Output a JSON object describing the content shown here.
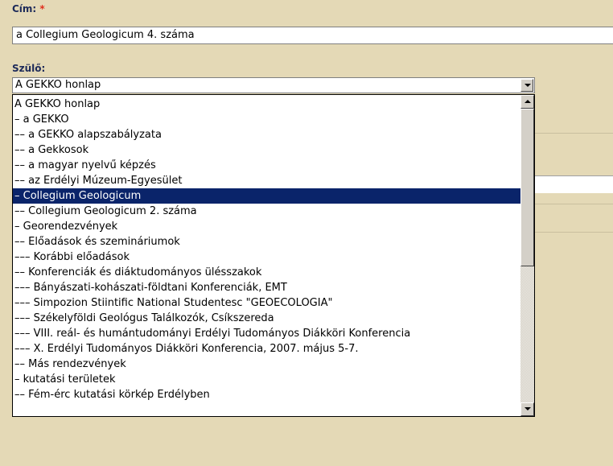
{
  "title_field": {
    "label": "Cím:",
    "required_mark": "*",
    "value": "a Collegium Geologicum 4. száma"
  },
  "parent_field": {
    "label": "Szülő:",
    "selected_value": "A GEKKO honlap"
  },
  "dropdown": {
    "highlight_color": "#0a246a",
    "items": [
      "A GEKKO honlap",
      "– a GEKKO",
      "–– a GEKKO alapszabályzata",
      "–– a Gekkosok",
      "–– a magyar nyelvű képzés",
      "–– az Erdélyi Múzeum-Egyesület",
      "– Collegium Geologicum",
      "–– Collegium Geologicum 2. száma",
      "– Georendezvények",
      "–– Előadások és szemináriumok",
      "––– Korábbi előadások",
      "–– Konferenciák és diáktudományos ülésszakok",
      "––– Bányászati-kohászati-földtani Konferenciák, EMT",
      "––– Simpozion Stiintific National Studentesc \"GEOECOLOGIA\"",
      "––– Székelyföldi Geológus Találkozók, Csíkszereda",
      "––– VIII. reál- és humántudományi Erdélyi Tudományos Diákköri Konferencia",
      "––– X. Erdélyi Tudományos Diákköri Konferencia, 2007. május 5-7.",
      "–– Más rendezvények",
      "– kutatási területek",
      "–– Fém-érc kutatási körkép Erdélyben"
    ],
    "selected_index": 6
  },
  "icons": {
    "dropdown_arrow": "triangle-down-icon",
    "scroll_up": "triangle-up-icon",
    "scroll_down": "triangle-down-icon"
  }
}
